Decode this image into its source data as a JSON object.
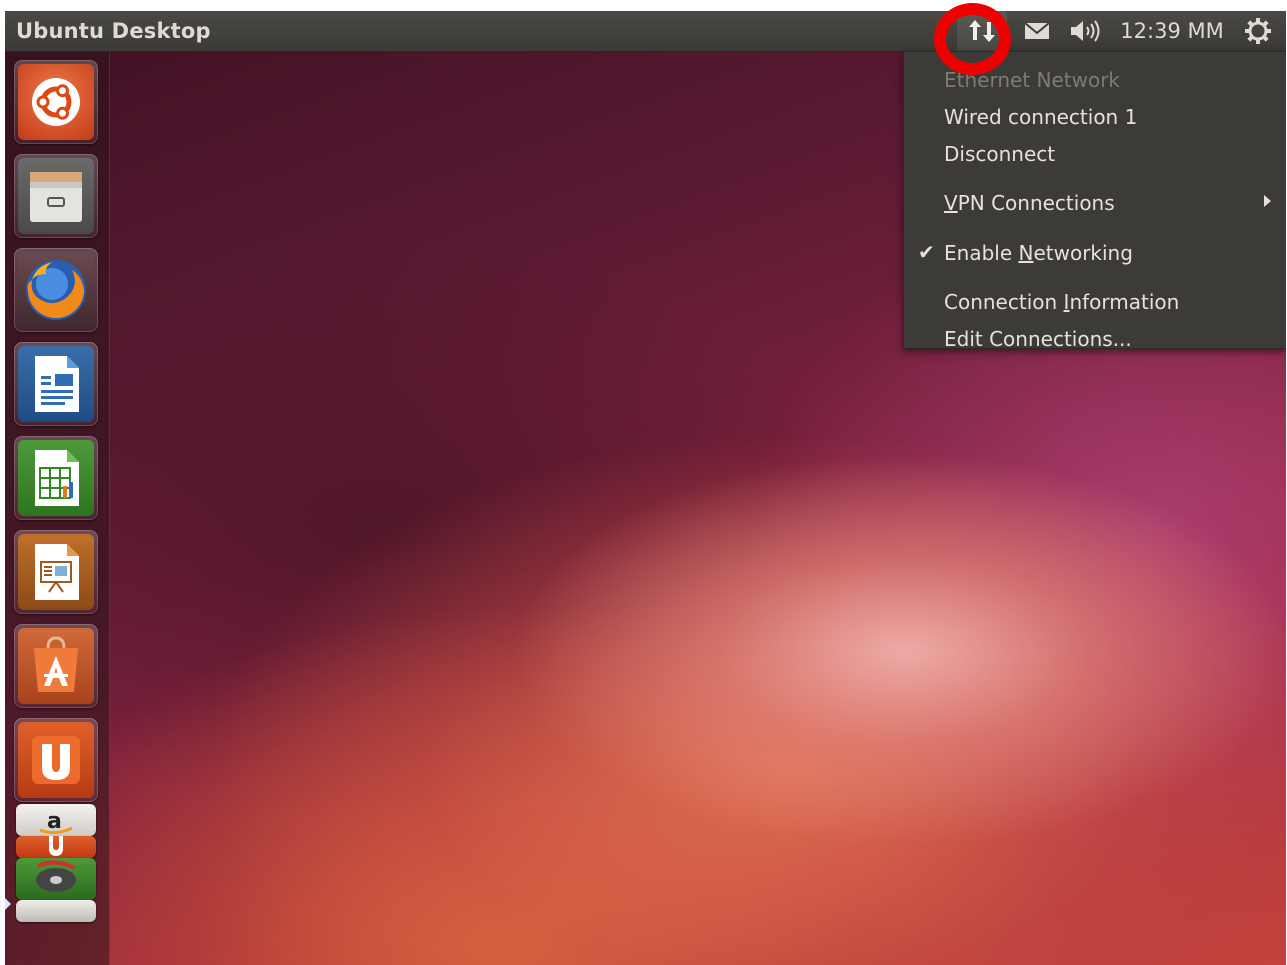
{
  "top_panel": {
    "title": "Ubuntu Desktop",
    "clock": "12:39 MM",
    "indicators": [
      "network-icon",
      "mail-icon",
      "sound-icon",
      "session-gear-icon"
    ]
  },
  "network_menu": {
    "header": "Ethernet Network",
    "items": [
      {
        "label": "Wired connection 1",
        "enabled": true
      },
      {
        "label": "Disconnect",
        "enabled": true
      },
      {
        "label_pre": "",
        "label_ul": "V",
        "label_post": "PN Connections",
        "submenu": true
      },
      {
        "label_pre": "Enable ",
        "label_ul": "N",
        "label_post": "etworking",
        "checked": true
      },
      {
        "label_pre": "Connection ",
        "label_ul": "I",
        "label_post": "nformation"
      },
      {
        "label": "Edit Connections..."
      }
    ]
  },
  "launcher": {
    "items": [
      "ubuntu-dash-icon",
      "files-icon",
      "firefox-icon",
      "libreoffice-writer-icon",
      "libreoffice-calc-icon",
      "libreoffice-impress-icon",
      "software-center-icon",
      "ubuntu-one-icon",
      "amazon-icon"
    ]
  },
  "colors": {
    "panel": "#3c3b37",
    "menu_text": "#e6e2da",
    "highlight_ring": "#ee0000",
    "ubuntu_orange": "#dd4814"
  }
}
